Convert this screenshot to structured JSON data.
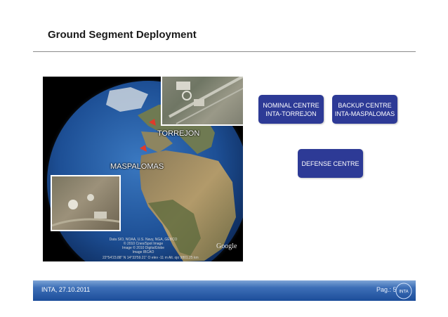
{
  "slide": {
    "title": "Ground Segment Deployment"
  },
  "map": {
    "labels": {
      "torrejon": "TORREJON",
      "maspalomas": "MASPALOMAS"
    },
    "attribution": [
      "Data SIO, NOAA, U.S. Navy, NGA, GEBCO",
      "© 2010 Cnes/Spot Image",
      "Image © 2010 DigitalGlobe",
      "Image IBCAO"
    ],
    "status_bar": "22°54'23.88\" N    14°33'59.21\" O   elev  -11 m                        Alt. ojo  9801.25 km",
    "provider_logo": "Google"
  },
  "centres": {
    "nominal": [
      "NOMINAL CENTRE",
      "INTA-TORREJON"
    ],
    "backup": [
      "BACKUP CENTRE",
      "INTA-MASPALOMAS"
    ],
    "defense": "DEFENSE CENTRE"
  },
  "footer": {
    "left": "INTA,  27.10.2011",
    "page": "Pag.: 5",
    "logo_text": "INTA"
  },
  "colors": {
    "box": "#2d3a96",
    "footer": "#1c4d9a"
  }
}
